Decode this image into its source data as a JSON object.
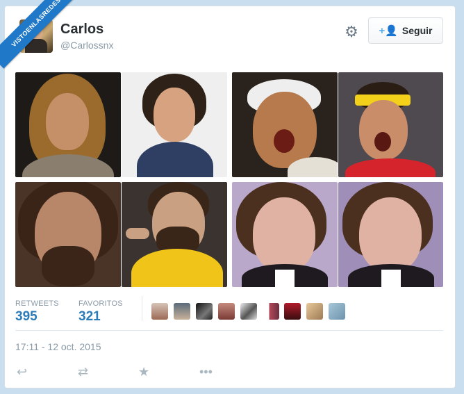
{
  "watermark": "VISTOENLASREDES",
  "user": {
    "name": "Carlos",
    "handle": "@Carlossnx"
  },
  "follow_label": "Seguir",
  "icons": {
    "settings": "gear-icon",
    "follow": "add-user-icon",
    "reply": "reply-icon",
    "retweet": "retweet-icon",
    "favorite": "star-icon",
    "more": "more-icon"
  },
  "stats": {
    "retweets_label": "RETWEETS",
    "retweets_value": "395",
    "favorites_label": "FAVORITOS",
    "favorites_value": "321"
  },
  "favorited_by_count_shown": 9,
  "timestamp": "17:11 - 12 oct. 2015",
  "colors": {
    "link": "#2b7bb9",
    "muted": "#8899a6",
    "accent": "#55acee",
    "ribbon": "#1f78c8"
  }
}
